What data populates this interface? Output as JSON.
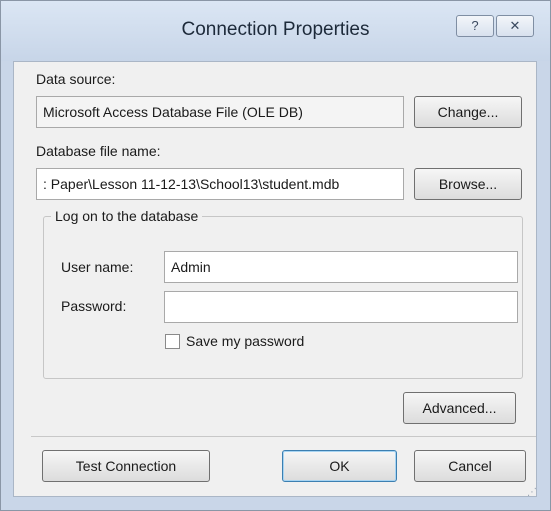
{
  "dialog": {
    "title": "Connection Properties",
    "help_glyph": "?",
    "close_glyph": "✕"
  },
  "data_source": {
    "label": "Data source:",
    "value": "Microsoft Access Database File (OLE DB)",
    "change_label": "Change..."
  },
  "database_file": {
    "label": "Database file name:",
    "value": ": Paper\\Lesson 11-12-13\\School13\\student.mdb",
    "browse_label": "Browse..."
  },
  "logon": {
    "group_title": "Log on to the database",
    "username_label": "User name:",
    "username_value": "Admin",
    "password_label": "Password:",
    "password_value": "",
    "save_password_label": "Save my password",
    "save_password_checked": false
  },
  "buttons": {
    "advanced": "Advanced...",
    "test_connection": "Test Connection",
    "ok": "OK",
    "cancel": "Cancel"
  }
}
